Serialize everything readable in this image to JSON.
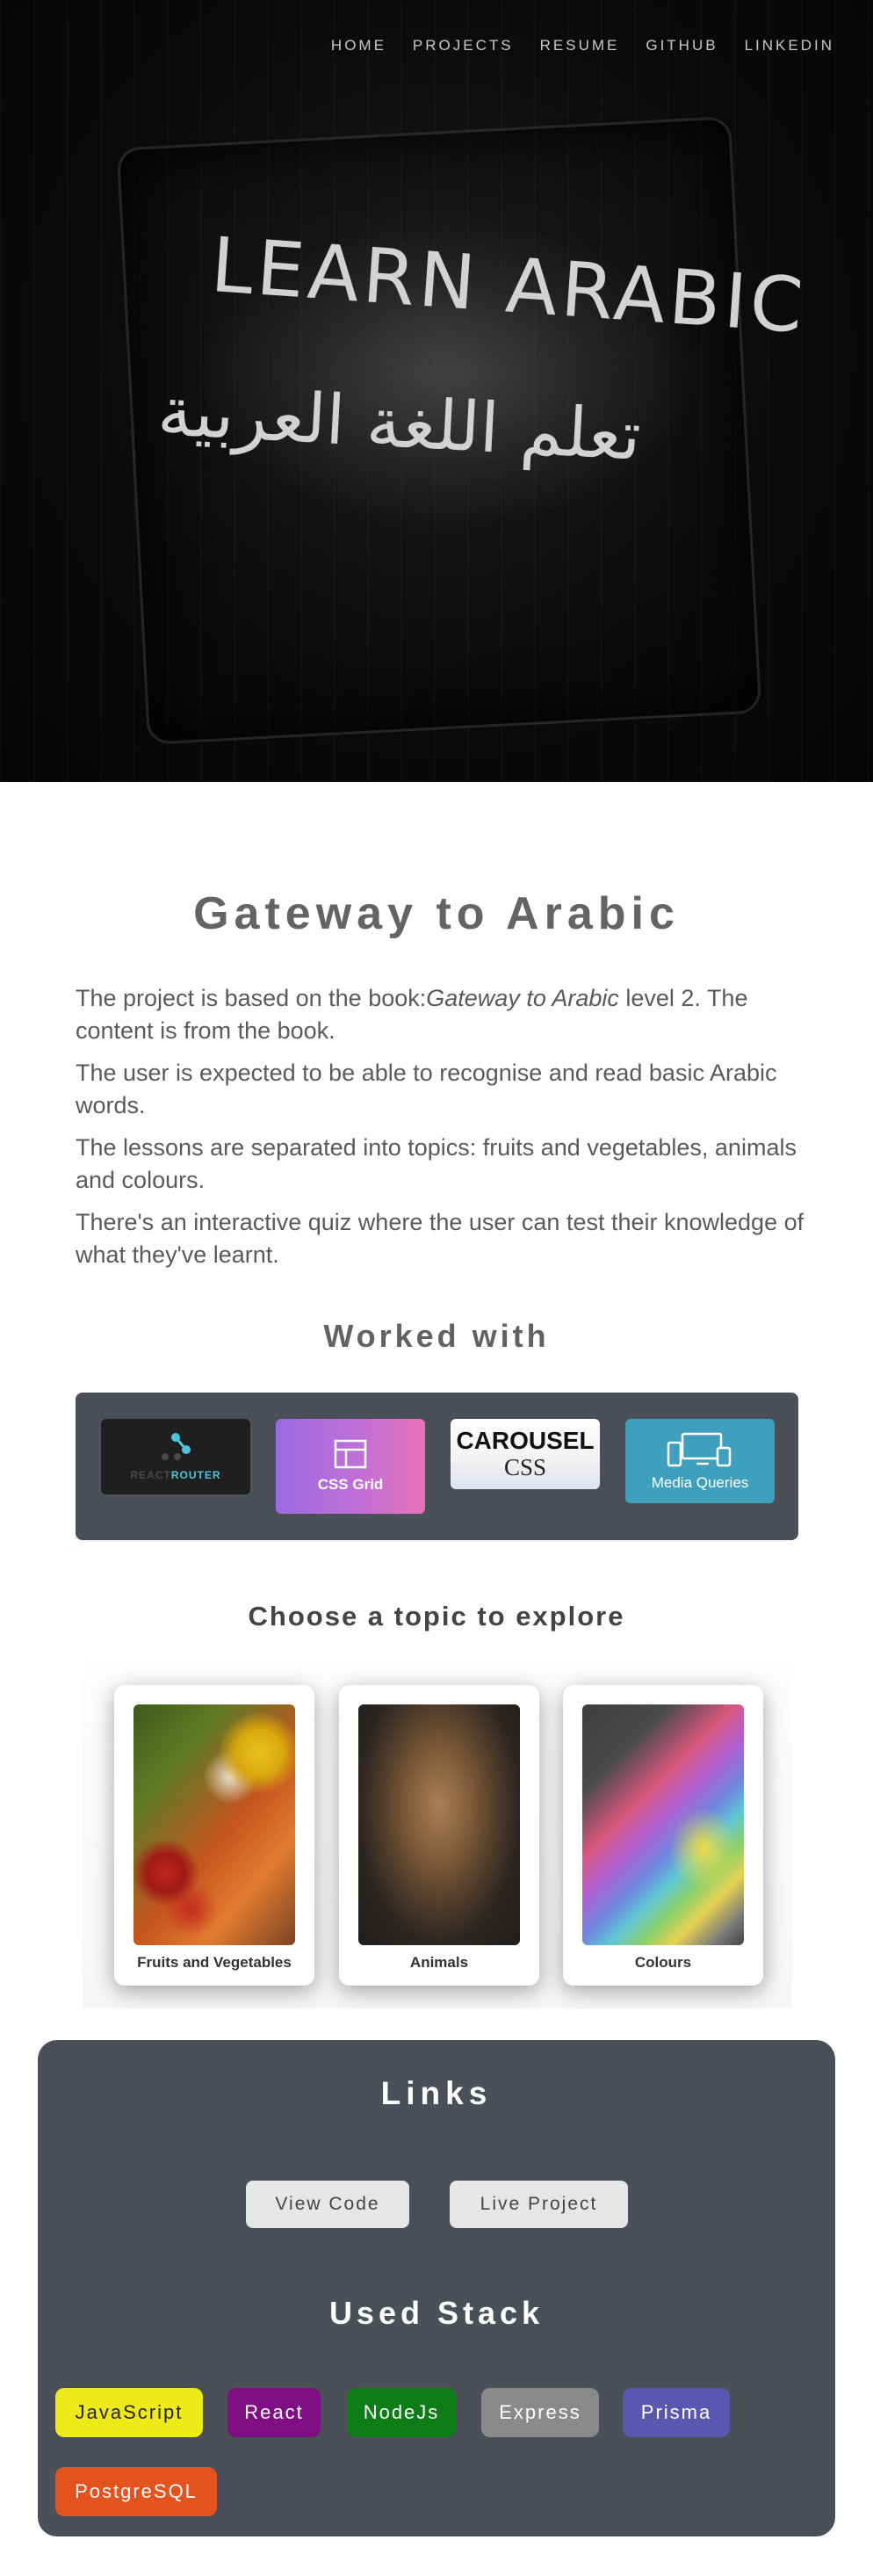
{
  "nav": {
    "items": [
      "HOME",
      "PROJECTS",
      "RESUME",
      "GITHUB",
      "LINKEDIN"
    ]
  },
  "hero": {
    "title_en": "LEARN ARABIC",
    "title_ar": "تعلم اللغة العربية"
  },
  "project": {
    "title": "Gateway to Arabic",
    "desc1_pre": "The project is based on the book:",
    "desc1_book": "Gateway to Arabic",
    "desc1_post": " level 2. The content is from the book.",
    "desc2": "The user is expected to be able to recognise and read basic Arabic words.",
    "desc3": "The lessons are separated into topics: fruits and vegetables, animals and colours.",
    "desc4": "There's an interactive quiz where the user can test their knowledge of what they've learnt."
  },
  "worked_with": {
    "title": "Worked with",
    "router_a": "REACT",
    "router_b": "ROUTER",
    "grid": "CSS Grid",
    "carousel_top": "CAROUSEL",
    "carousel_bottom": "CSS",
    "media_queries": "Media Queries"
  },
  "topics": {
    "title": "Choose a topic to explore",
    "cards": [
      {
        "label": "Fruits and Vegetables"
      },
      {
        "label": "Animals"
      },
      {
        "label": "Colours"
      }
    ]
  },
  "links": {
    "title": "Links",
    "view_code": "View Code",
    "live_project": "Live Project"
  },
  "stack": {
    "title": "Used Stack",
    "chips": [
      "JavaScript",
      "React",
      "NodeJs",
      "Express",
      "Prisma",
      "PostgreSQL"
    ],
    "colors": {
      "JavaScript": "#eeea1a",
      "React": "#7f0f82",
      "NodeJs": "#0e7d18",
      "Express": "#8a8a8a",
      "Prisma": "#5b57b0",
      "PostgreSQL": "#e4521e"
    }
  },
  "colors": {
    "panel": "#4a4f58",
    "heading": "#646464"
  }
}
